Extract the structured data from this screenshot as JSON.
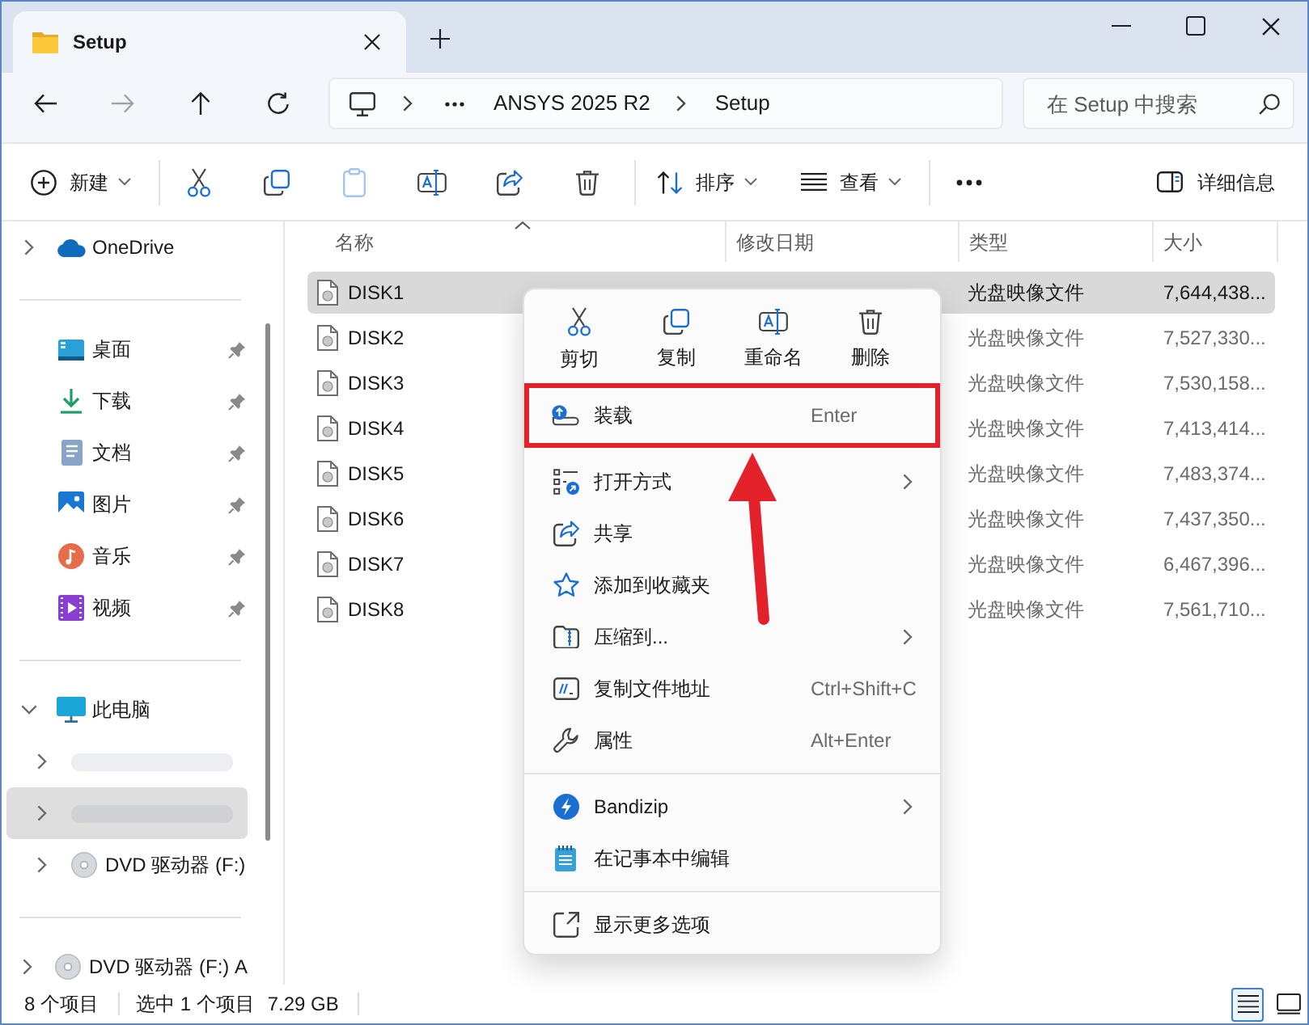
{
  "window": {
    "tab_title": "Setup"
  },
  "nav": {
    "buttons": [
      {
        "kind": "back",
        "disabled": false
      },
      {
        "kind": "forward",
        "disabled": true
      },
      {
        "kind": "up",
        "disabled": false
      },
      {
        "kind": "refresh",
        "disabled": false
      }
    ],
    "address": {
      "segments": [
        "ANSYS 2025 R2",
        "Setup"
      ]
    },
    "search": {
      "placeholder": "在 Setup 中搜索"
    }
  },
  "toolbar": {
    "groups": [
      {
        "items": [
          {
            "kind": "new",
            "label": "新建",
            "dropdown": true,
            "disabled": false
          }
        ]
      },
      {
        "items": [
          {
            "kind": "cut",
            "disabled": false
          },
          {
            "kind": "copy",
            "disabled": false
          },
          {
            "kind": "paste",
            "disabled": true
          },
          {
            "kind": "rename",
            "disabled": false
          },
          {
            "kind": "share",
            "disabled": false
          },
          {
            "kind": "delete",
            "disabled": false
          }
        ]
      },
      {
        "items": [
          {
            "kind": "sort",
            "label": "排序",
            "dropdown": true,
            "disabled": false
          },
          {
            "kind": "view",
            "label": "查看",
            "dropdown": true,
            "disabled": false
          }
        ]
      },
      {
        "items": [
          {
            "kind": "more",
            "disabled": false
          }
        ]
      }
    ],
    "details_pane": {
      "label": "详细信息"
    }
  },
  "sidebar": {
    "sections": [
      {
        "items": [
          {
            "kind": "onedrive",
            "label": "OneDrive",
            "expanded": false,
            "selected": false
          }
        ]
      },
      {
        "items": [
          {
            "kind": "desktop",
            "label": "桌面",
            "pinned": true,
            "selected": false
          },
          {
            "kind": "downloads",
            "label": "下载",
            "pinned": true,
            "selected": false
          },
          {
            "kind": "documents",
            "label": "文档",
            "pinned": true,
            "selected": false
          },
          {
            "kind": "pictures",
            "label": "图片",
            "pinned": true,
            "selected": false
          },
          {
            "kind": "music",
            "label": "音乐",
            "pinned": true,
            "selected": false
          },
          {
            "kind": "videos",
            "label": "视频",
            "pinned": true,
            "selected": false
          }
        ]
      },
      {
        "items": [
          {
            "kind": "pc",
            "label": "此电脑",
            "expanded": true,
            "selected": false,
            "children": [
              {
                "kind": "obscured",
                "expanded": false,
                "selected": false
              },
              {
                "kind": "obscured",
                "expanded": false,
                "selected": true
              },
              {
                "kind": "dvd",
                "label": "DVD 驱动器 (F:)",
                "expanded": false,
                "selected": false
              }
            ]
          }
        ]
      },
      {
        "items": [
          {
            "kind": "dvd",
            "label": "DVD 驱动器 (F:) A",
            "expanded": false,
            "selected": false
          }
        ]
      }
    ]
  },
  "file_list": {
    "columns": [
      {
        "label": "名称",
        "sorted": true
      },
      {
        "label": "修改日期",
        "sorted": false
      },
      {
        "label": "类型",
        "sorted": false
      },
      {
        "label": "大小",
        "sorted": false
      }
    ],
    "rows": [
      {
        "name": "DISK1",
        "type": "光盘映像文件",
        "size": "7,644,438...",
        "selected": true
      },
      {
        "name": "DISK2",
        "type": "光盘映像文件",
        "size": "7,527,330...",
        "selected": false
      },
      {
        "name": "DISK3",
        "type": "光盘映像文件",
        "size": "7,530,158...",
        "selected": false
      },
      {
        "name": "DISK4",
        "type": "光盘映像文件",
        "size": "7,413,414...",
        "selected": false
      },
      {
        "name": "DISK5",
        "type": "光盘映像文件",
        "size": "7,483,374...",
        "selected": false
      },
      {
        "name": "DISK6",
        "type": "光盘映像文件",
        "size": "7,437,350...",
        "selected": false
      },
      {
        "name": "DISK7",
        "type": "光盘映像文件",
        "size": "6,467,396...",
        "selected": false
      },
      {
        "name": "DISK8",
        "type": "光盘映像文件",
        "size": "7,561,710...",
        "selected": false
      }
    ]
  },
  "context_menu": {
    "actions": [
      {
        "kind": "cut",
        "label": "剪切"
      },
      {
        "kind": "copy",
        "label": "复制"
      },
      {
        "kind": "rename",
        "label": "重命名"
      },
      {
        "kind": "delete",
        "label": "删除"
      }
    ],
    "items": [
      {
        "kind": "mount",
        "label": "装载",
        "shortcut": "Enter",
        "submenu": false,
        "callout": true,
        "divider_before": false
      },
      {
        "kind": "open_with",
        "label": "打开方式",
        "submenu": true,
        "callout": false,
        "divider_before": false
      },
      {
        "kind": "share",
        "label": "共享",
        "submenu": false,
        "callout": false,
        "divider_before": false
      },
      {
        "kind": "favorite",
        "label": "添加到收藏夹",
        "submenu": false,
        "callout": false,
        "divider_before": false
      },
      {
        "kind": "compress",
        "label": "压缩到...",
        "submenu": true,
        "callout": false,
        "divider_before": false
      },
      {
        "kind": "copy_path",
        "label": "复制文件地址",
        "shortcut": "Ctrl+Shift+C",
        "submenu": false,
        "callout": false,
        "divider_before": false
      },
      {
        "kind": "properties",
        "label": "属性",
        "shortcut": "Alt+Enter",
        "submenu": false,
        "callout": false,
        "divider_before": false
      },
      {
        "kind": "bandizip",
        "label": "Bandizip",
        "submenu": true,
        "callout": false,
        "divider_before": true
      },
      {
        "kind": "notepad",
        "label": "在记事本中编辑",
        "submenu": false,
        "callout": false,
        "divider_before": false
      },
      {
        "kind": "more_options",
        "label": "显示更多选项",
        "submenu": false,
        "callout": false,
        "divider_before": true
      }
    ]
  },
  "status_bar": {
    "item_count": "8 个项目",
    "selection": "选中 1 个项目",
    "selection_size": "7.29 GB",
    "views": [
      {
        "kind": "details",
        "selected": true
      },
      {
        "kind": "tiles",
        "selected": false
      }
    ]
  }
}
